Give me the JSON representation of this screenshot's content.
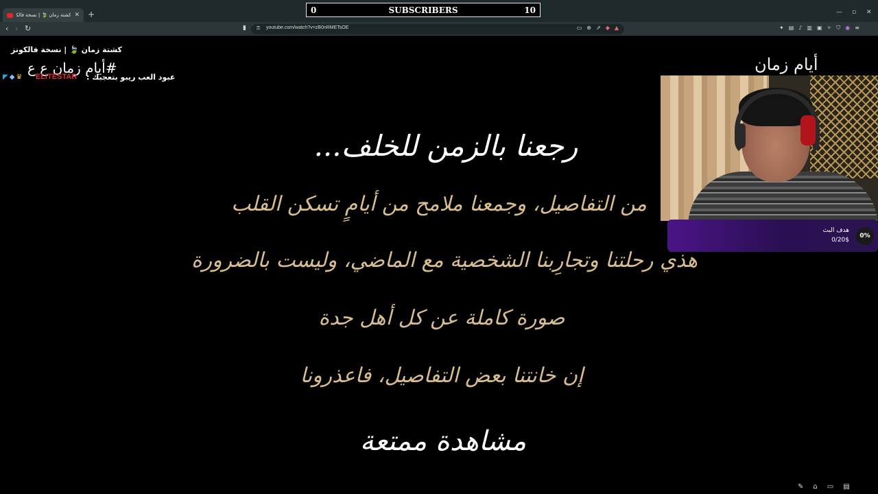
{
  "browser": {
    "tab_title": "كشتة زمان 🍃 | نسخة فالكونز - Yo",
    "url": "youtube.com/watch?v=zB0nRMETsOE",
    "icons": [
      "back-icon",
      "forward-icon",
      "reload-icon",
      "bookmark-icon",
      "lock-icon",
      "new-tab-icon",
      "minimize-icon",
      "maximize-icon",
      "close-icon"
    ]
  },
  "subscribers": {
    "start": "0",
    "label": "SUBSCRIBERS",
    "goal": "10"
  },
  "video": {
    "title": "كشتة زمان 🍃 | نسخة فالكونز",
    "hashtag": "#أيام زمان ع ع",
    "elite_tag": "ELITESTAR",
    "channel_line": "عبود العب ريبو بتعجبك :",
    "corner_title": "أيام زمان"
  },
  "intro_text": {
    "heading": "رجعنا بالزمن للخلف...",
    "line1": "من التفاصيل، وجمعنا ملامح من أيامٍ تسكن القلب",
    "line2": "هذي رحلتنا وتجارِبنا الشخصية مع الماضي، وليست بالضرورة",
    "line3": "صورة كاملة عن كل أهل جدة",
    "line4": "إن خانتنا بعض التفاصيل، فاعذرونا",
    "closing": "مشاهدة ممتعة"
  },
  "donation_goal": {
    "percent": "0%",
    "label": "هدف البث",
    "amount": "0/20$",
    "progress": 0
  },
  "colors": {
    "body_text": "#d8bd8e",
    "goal_gradient_start": "#4a1487",
    "goal_gradient_end": "#2a1550",
    "elite": "#e0303a"
  }
}
